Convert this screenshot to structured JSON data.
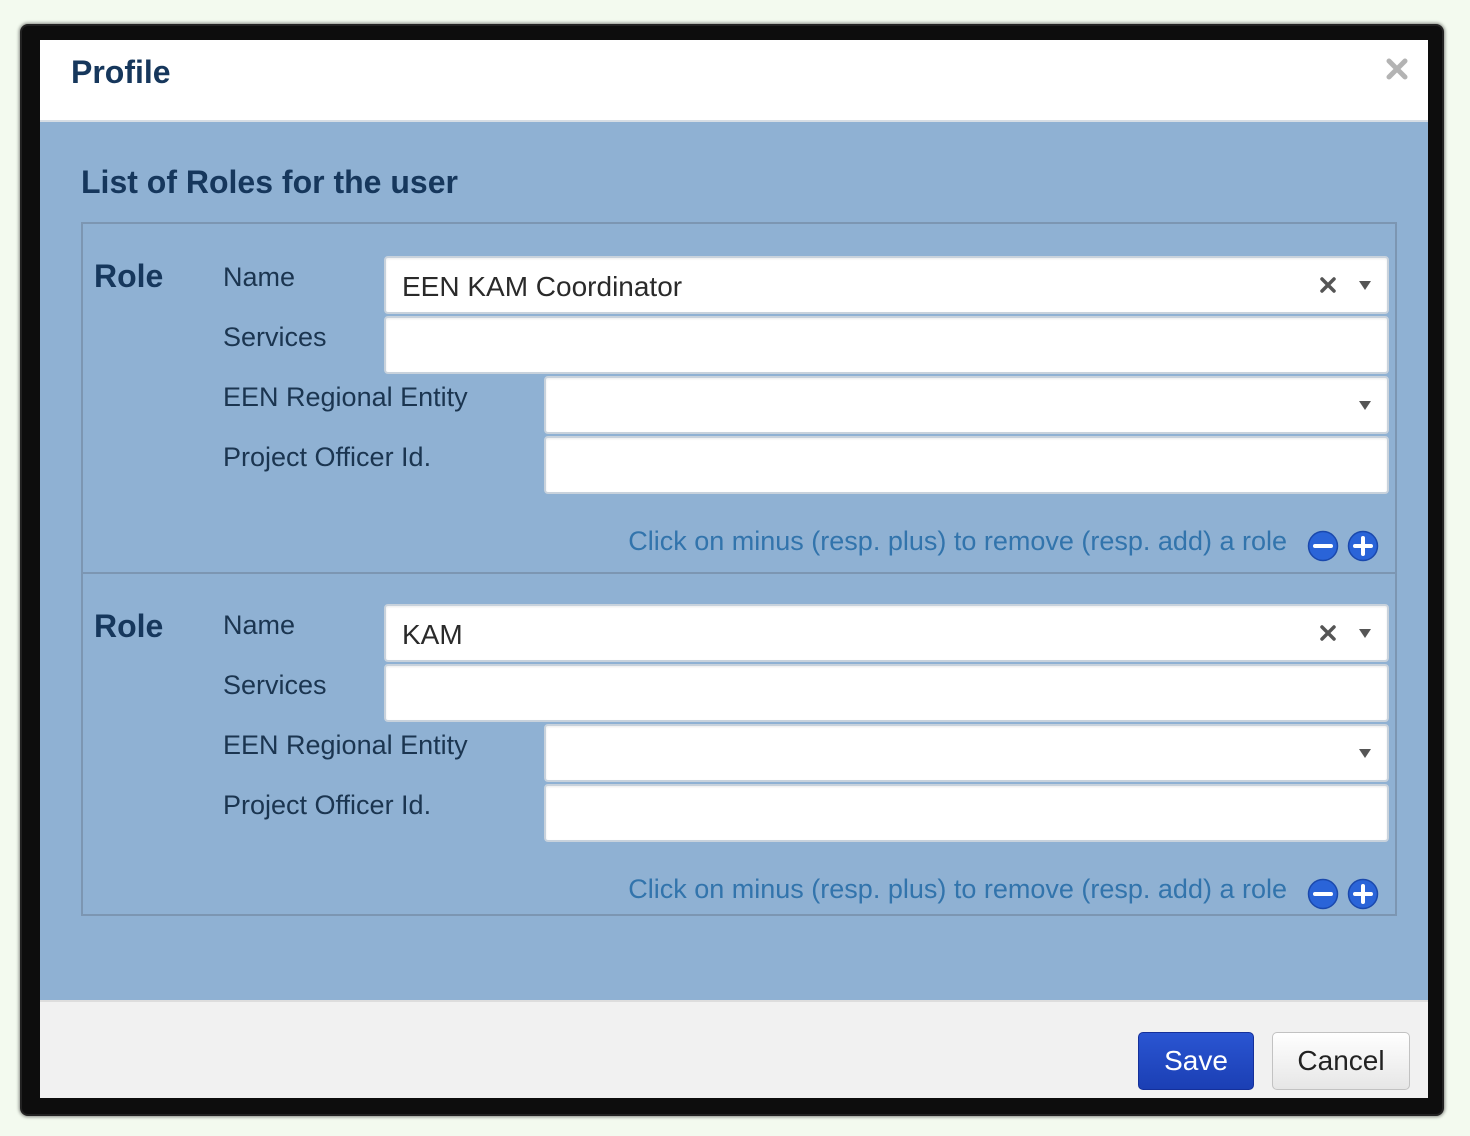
{
  "dialog": {
    "title": "Profile",
    "close_icon": "close-icon"
  },
  "body": {
    "section_title": "List of Roles for the user"
  },
  "roles": [
    {
      "heading": "Role",
      "name_label": "Name",
      "name_value": "EEN KAM Coordinator",
      "services_label": "Services",
      "services_value": "",
      "regional_entity_label": "EEN Regional Entity",
      "regional_entity_value": "",
      "project_officer_label": "Project Officer Id.",
      "project_officer_value": "",
      "hint": "Click on minus (resp. plus) to remove (resp. add) a role"
    },
    {
      "heading": "Role",
      "name_label": "Name",
      "name_value": "KAM",
      "services_label": "Services",
      "services_value": "",
      "regional_entity_label": "EEN Regional Entity",
      "regional_entity_value": "",
      "project_officer_label": "Project Officer Id.",
      "project_officer_value": "",
      "hint": "Click on minus (resp. plus) to remove (resp. add) a role"
    }
  ],
  "footer": {
    "save_label": "Save",
    "cancel_label": "Cancel"
  },
  "colors": {
    "body_background": "#8fb1d3",
    "title_text": "#16375c",
    "hint_text": "#3274ac",
    "save_button": "#1b3fb4"
  },
  "icons": [
    "close-icon",
    "clear-icon",
    "chevron-down-icon",
    "minus-circle-icon",
    "plus-circle-icon"
  ]
}
